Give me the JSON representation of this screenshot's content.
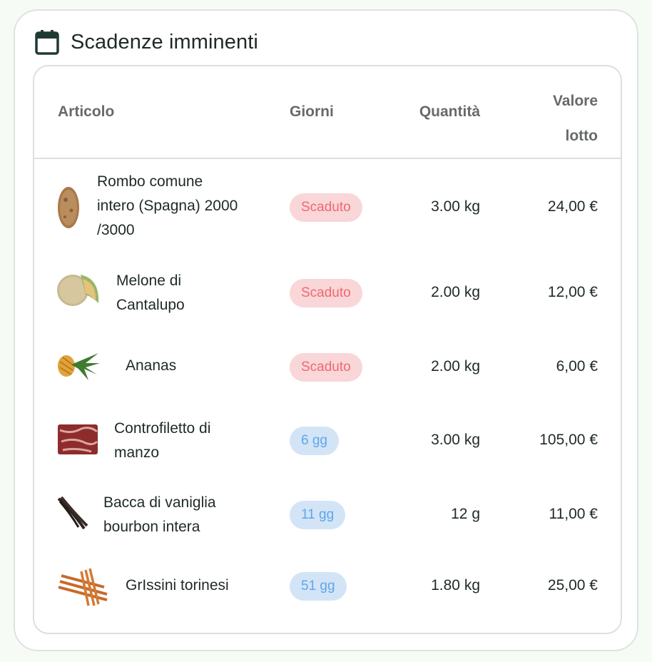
{
  "header": {
    "title": "Scadenze imminenti",
    "icon": "calendar-icon"
  },
  "table": {
    "columns": {
      "item": "Articolo",
      "days": "Giorni",
      "qty": "Quantità",
      "value_line1": "Valore",
      "value_line2": "lotto"
    },
    "rows": [
      {
        "name": "Rombo comune intero (Spagna) 2000 /3000",
        "status": "Scaduto",
        "qty": "3.00 kg",
        "value": "24,00 €",
        "thumb": "fish-icon"
      },
      {
        "name": "Melone di Cantalupo",
        "status": "Scaduto",
        "qty": "2.00 kg",
        "value": "12,00 €",
        "thumb": "melon-icon"
      },
      {
        "name": "Ananas",
        "status": "Scaduto",
        "qty": "2.00 kg",
        "value": "6,00 €",
        "thumb": "pineapple-icon"
      },
      {
        "name": "Controfiletto di manzo",
        "status": "6 gg",
        "qty": "3.00 kg",
        "value": "105,00 €",
        "thumb": "beef-icon"
      },
      {
        "name": "Bacca di vaniglia bourbon intera",
        "status": "11 gg",
        "qty": "12 g",
        "value": "11,00 €",
        "thumb": "vanilla-icon"
      },
      {
        "name": "GrIssini torinesi",
        "status": "51 gg",
        "qty": "1.80 kg",
        "value": "25,00 €",
        "thumb": "breadsticks-icon"
      }
    ]
  },
  "colors": {
    "expired_bg": "#f9d6d8",
    "expired_text": "#ee6971",
    "days_bg": "#d3e4f7",
    "days_text": "#5da7ea"
  }
}
